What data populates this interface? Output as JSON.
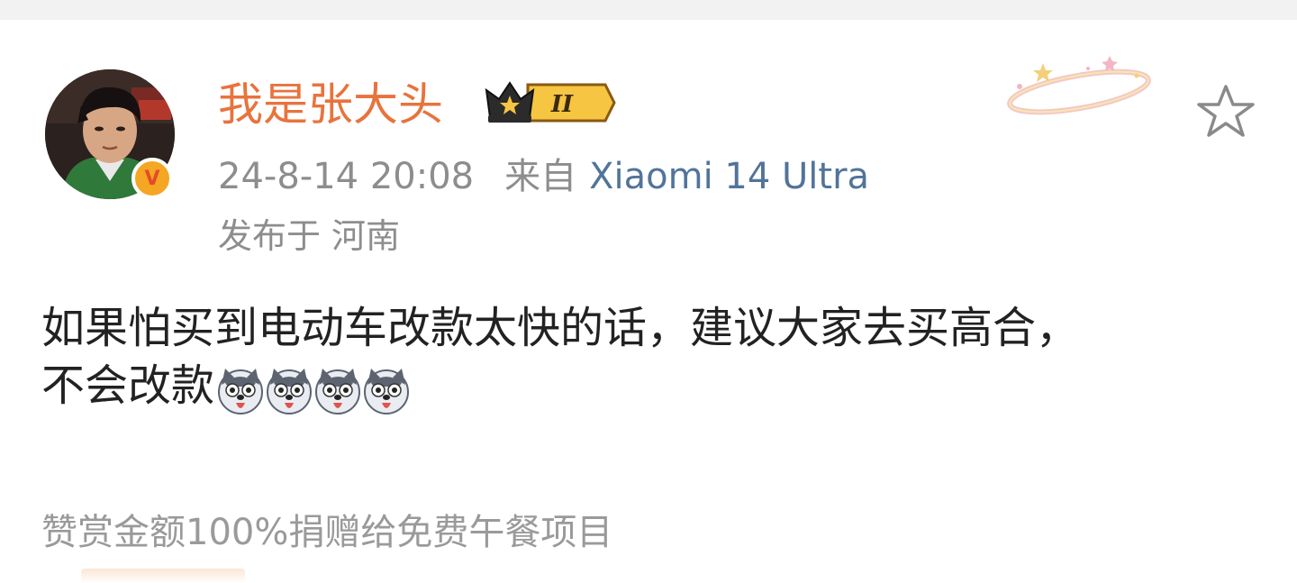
{
  "post": {
    "username": "我是张大头",
    "verified_badge": "V",
    "level_badge": "II",
    "time": "24-8-14 20:08",
    "from_label": "来自",
    "device": "Xiaomi 14 Ultra",
    "location_label": "发布于",
    "location": "河南",
    "text_line1": "如果怕买到电动车改款太快的话，建议大家去买高合，",
    "text_line2": "不会改款",
    "emojis": [
      "husky-dog-emoji",
      "husky-dog-emoji",
      "husky-dog-emoji",
      "husky-dog-emoji"
    ],
    "reward_note": "赞赏金额100%捐赠给免费午餐项目"
  },
  "icons": {
    "favorite": "star-outline-icon",
    "crown": "crown-icon",
    "halo": "halo-decoration-icon"
  },
  "colors": {
    "username": "#e8733d",
    "device_link": "#52749a",
    "meta_text": "#8d8d8d",
    "body_text": "#222222",
    "badge_gold": "#f5a623"
  }
}
